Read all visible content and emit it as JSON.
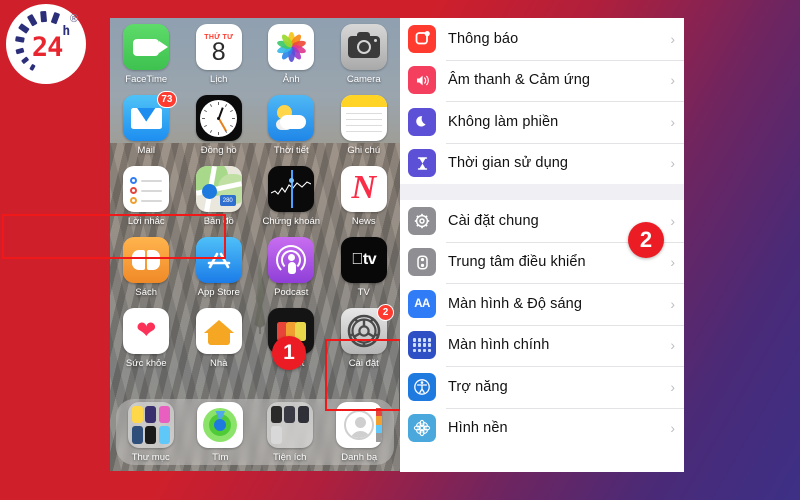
{
  "brand": {
    "name": "24h",
    "number": "24",
    "superscript": "h",
    "registered": "®"
  },
  "home_screen": {
    "name": "iphone-home-screen",
    "rows": [
      [
        {
          "label": "FaceTime",
          "icon": "facetime-icon",
          "badge": null
        },
        {
          "label": "Lịch",
          "icon": "calendar-icon",
          "badge": null,
          "day_of_week": "THỨ TƯ",
          "day_number": "8"
        },
        {
          "label": "Ảnh",
          "icon": "photos-icon",
          "badge": null
        },
        {
          "label": "Camera",
          "icon": "camera-icon",
          "badge": null
        }
      ],
      [
        {
          "label": "Mail",
          "icon": "mail-icon",
          "badge": "73"
        },
        {
          "label": "Đồng hồ",
          "icon": "clock-icon",
          "badge": null
        },
        {
          "label": "Thời tiết",
          "icon": "weather-icon",
          "badge": null
        },
        {
          "label": "Ghi chú",
          "icon": "notes-icon",
          "badge": null
        }
      ],
      [
        {
          "label": "Lời nhắc",
          "icon": "reminders-icon",
          "badge": null
        },
        {
          "label": "Bản đồ",
          "icon": "maps-icon",
          "badge": null,
          "route_shield": "280"
        },
        {
          "label": "Chứng khoán",
          "icon": "stocks-icon",
          "badge": null
        },
        {
          "label": "News",
          "icon": "news-icon",
          "badge": null
        }
      ],
      [
        {
          "label": "Sách",
          "icon": "books-icon",
          "badge": null
        },
        {
          "label": "App Store",
          "icon": "app-store-icon",
          "badge": null
        },
        {
          "label": "Podcast",
          "icon": "podcasts-icon",
          "badge": null
        },
        {
          "label": "TV",
          "icon": "apple-tv-icon",
          "badge": null
        }
      ],
      [
        {
          "label": "Sức khỏe",
          "icon": "health-icon",
          "badge": null
        },
        {
          "label": "Nhà",
          "icon": "home-app-icon",
          "badge": null
        },
        {
          "label": "Wallet",
          "icon": "wallet-icon",
          "badge": null
        },
        {
          "label": "Cài đặt",
          "icon": "settings-icon",
          "badge": "2"
        }
      ]
    ],
    "dock": [
      {
        "label": "Thư mục",
        "icon": "folder-icon"
      },
      {
        "label": "Tìm",
        "icon": "find-my-icon"
      },
      {
        "label": "Tiện ích",
        "icon": "utilities-folder-icon"
      },
      {
        "label": "Danh bạ",
        "icon": "contacts-icon"
      }
    ]
  },
  "settings_panel": {
    "name": "ios-settings-list",
    "groups": [
      {
        "rows": [
          {
            "label": "Thông báo",
            "icon": "notifications-icon",
            "color": "#ff3b30",
            "glyph": "▣"
          },
          {
            "label": "Âm thanh & Cảm ứng",
            "icon": "sounds-haptics-icon",
            "color": "#f43f5e",
            "glyph": "🔊"
          },
          {
            "label": "Không làm phiền",
            "icon": "do-not-disturb-icon",
            "color": "#5b50d6",
            "glyph": "☾"
          },
          {
            "label": "Thời gian sử dụng",
            "icon": "screen-time-icon",
            "color": "#5b50d6",
            "glyph": "⌛"
          }
        ]
      },
      {
        "rows": [
          {
            "label": "Cài đặt chung",
            "icon": "general-icon",
            "color": "#8e8e93",
            "glyph": "⚙",
            "highlighted": true
          },
          {
            "label": "Trung tâm điều khiển",
            "icon": "control-center-icon",
            "color": "#8e8e93",
            "glyph": "⌸"
          },
          {
            "label": "Màn hình & Độ sáng",
            "icon": "display-brightness-icon",
            "color": "#2f7cf6",
            "glyph": "AA"
          },
          {
            "label": "Màn hình chính",
            "icon": "home-screen-icon",
            "color": "#2f4fc4",
            "glyph": "grid"
          },
          {
            "label": "Trợ năng",
            "icon": "accessibility-icon",
            "color": "#1f7ae0",
            "glyph": "♿"
          },
          {
            "label": "Hình nền",
            "icon": "wallpaper-icon",
            "color": "#4aa8dd",
            "glyph": "✿"
          }
        ]
      }
    ],
    "chevron": "›"
  },
  "annotations": {
    "marker_one": "1",
    "marker_two": "2",
    "highlight_color": "#f01818",
    "marker_color": "#ec1c24"
  }
}
